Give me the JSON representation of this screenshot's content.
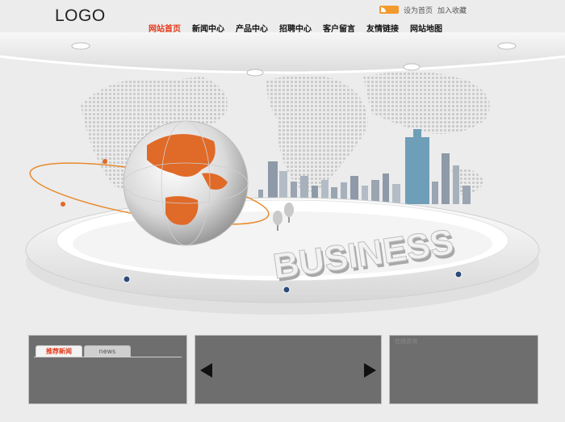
{
  "header": {
    "logo": "LOGO",
    "top_links": {
      "set_home": "设为首页",
      "bookmark": "加入收藏"
    }
  },
  "nav": {
    "items": [
      {
        "label": "网站首页",
        "active": true
      },
      {
        "label": "新闻中心",
        "active": false
      },
      {
        "label": "产品中心",
        "active": false
      },
      {
        "label": "招聘中心",
        "active": false
      },
      {
        "label": "客户留言",
        "active": false
      },
      {
        "label": "友情链接",
        "active": false
      },
      {
        "label": "网站地图",
        "active": false
      }
    ]
  },
  "banner": {
    "word": "BUSINESS"
  },
  "panels": {
    "news": {
      "tab_active": "推荐新闻",
      "tab_inactive": "news"
    },
    "gallery": {
      "prev": "prev-arrow",
      "next": "next-arrow"
    },
    "right": {
      "label": "在线咨询"
    }
  },
  "colors": {
    "accent": "#e33a1a",
    "panel": "#6e6e6e",
    "globe": "#e06a28"
  }
}
